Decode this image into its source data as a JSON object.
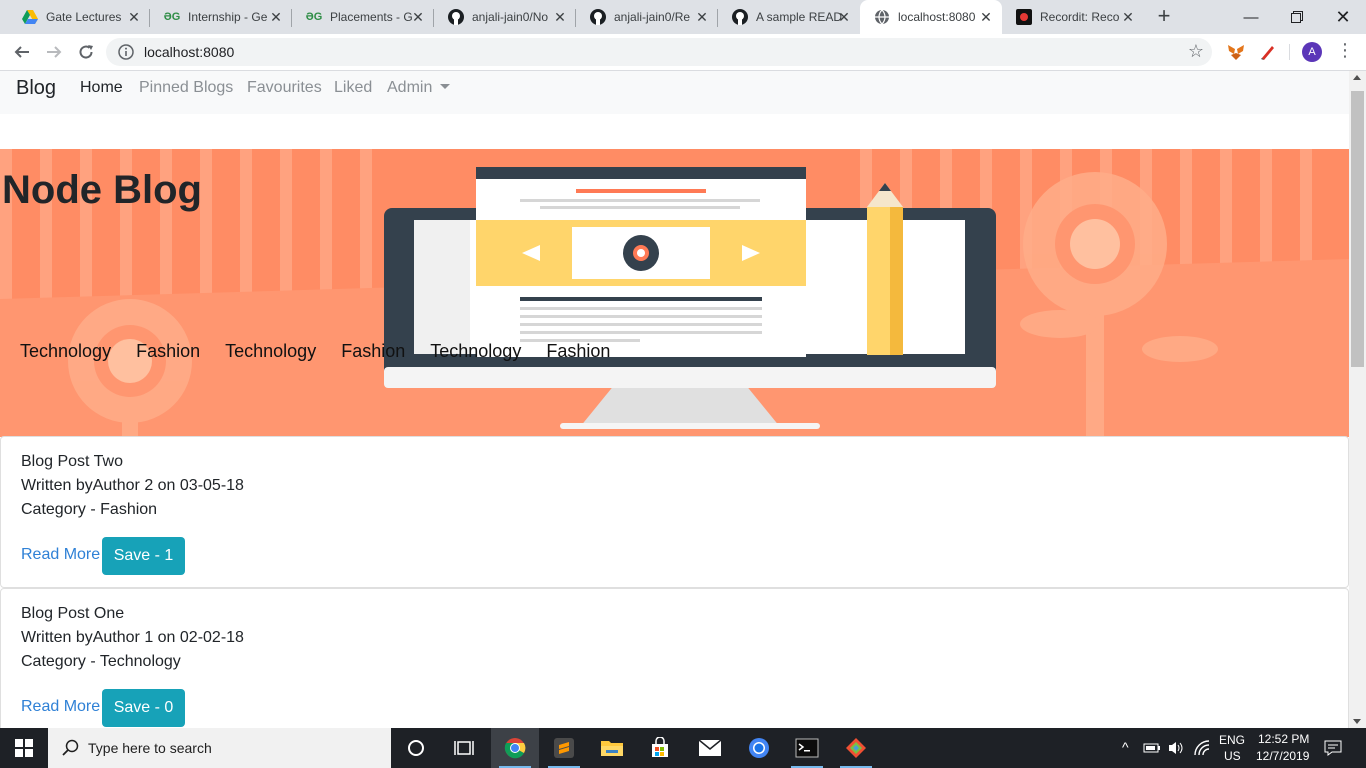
{
  "browser": {
    "tabs": [
      {
        "title": "Gate Lectures",
        "icon": "google-drive-icon"
      },
      {
        "title": "Internship - Ge",
        "icon": "geeksforgeeks-icon"
      },
      {
        "title": "Placements - G",
        "icon": "geeksforgeeks-icon"
      },
      {
        "title": "anjali-jain0/No",
        "icon": "github-icon"
      },
      {
        "title": "anjali-jain0/Re",
        "icon": "github-icon"
      },
      {
        "title": "A sample READ",
        "icon": "github-icon"
      },
      {
        "title": "localhost:8080",
        "icon": "globe-icon",
        "active": true
      },
      {
        "title": "Recordit: Reco",
        "icon": "recordit-icon"
      }
    ],
    "url": "localhost:8080",
    "profile_initial": "A"
  },
  "navbar": {
    "brand": "Blog",
    "links": [
      "Home",
      "Pinned Blogs",
      "Favourites",
      "Liked",
      "Admin"
    ]
  },
  "hero": {
    "title": "Node Blog",
    "tags": [
      "Technology",
      "Fashion",
      "Technology",
      "Fashion",
      "Technology",
      "Fashion"
    ]
  },
  "posts": [
    {
      "title": "Blog Post Two",
      "byline": "Written byAuthor 2 on 03-05-18",
      "category": "Category - Fashion",
      "read_more": "Read More",
      "save": "Save - 1"
    },
    {
      "title": "Blog Post One",
      "byline": "Written byAuthor 1 on 02-02-18",
      "category": "Category - Technology",
      "read_more": "Read More",
      "save": "Save - 0"
    }
  ],
  "taskbar": {
    "search_placeholder": "Type here to search",
    "language": "ENG",
    "region": "US",
    "time": "12:52 PM",
    "date": "12/7/2019"
  },
  "colors": {
    "hero_bg": "#ff8c64",
    "save_button": "#17a2b8",
    "link": "#2f81d6"
  }
}
